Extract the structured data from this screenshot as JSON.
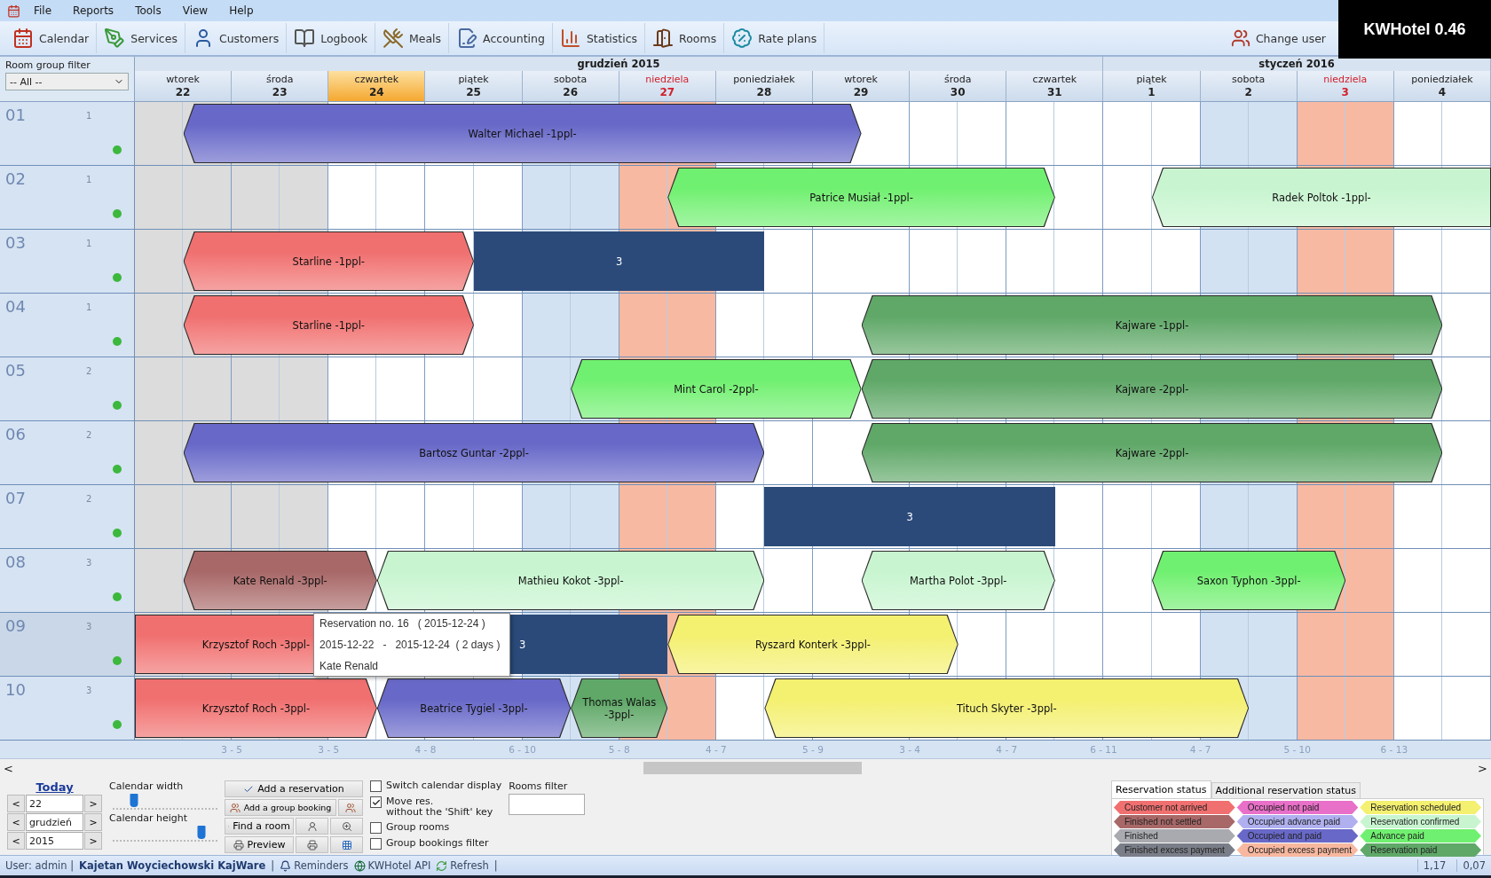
{
  "menu": [
    "File",
    "Reports",
    "Tools",
    "View",
    "Help"
  ],
  "toolbar": [
    {
      "label": "Calendar",
      "kind": "calendar"
    },
    {
      "label": "Services",
      "kind": "services"
    },
    {
      "label": "Customers",
      "kind": "customers"
    },
    {
      "label": "Logbook",
      "kind": "logbook"
    },
    {
      "label": "Meals",
      "kind": "meals"
    },
    {
      "label": "Accounting",
      "kind": "accounting"
    },
    {
      "label": "Statistics",
      "kind": "statistics"
    },
    {
      "label": "Rooms",
      "kind": "rooms"
    },
    {
      "label": "Rate plans",
      "kind": "rates"
    }
  ],
  "change_user": "Change user",
  "badge": "KWHotel 0.46",
  "room_filter": {
    "label": "Room group filter",
    "value": "-- All --"
  },
  "calendar": {
    "months": [
      {
        "label": "grudzień  2015",
        "days": [
          {
            "weekday": "wtorek",
            "day": "22",
            "kind": "weekday",
            "selected": false
          },
          {
            "weekday": "środa",
            "day": "23",
            "kind": "weekday",
            "selected": false
          },
          {
            "weekday": "czwartek",
            "day": "24",
            "kind": "weekday",
            "selected": true
          },
          {
            "weekday": "piątek",
            "day": "25",
            "kind": "weekday",
            "selected": false
          },
          {
            "weekday": "sobota",
            "day": "26",
            "kind": "saturday",
            "selected": false
          },
          {
            "weekday": "niedziela",
            "day": "27",
            "kind": "sunday",
            "selected": false
          },
          {
            "weekday": "poniedziałek",
            "day": "28",
            "kind": "weekday",
            "selected": false
          },
          {
            "weekday": "wtorek",
            "day": "29",
            "kind": "weekday",
            "selected": false
          },
          {
            "weekday": "środa",
            "day": "30",
            "kind": "weekday",
            "selected": false
          },
          {
            "weekday": "czwartek",
            "day": "31",
            "kind": "weekday",
            "selected": false
          }
        ]
      },
      {
        "label": "styczeń  2016",
        "days": [
          {
            "weekday": "piątek",
            "day": "1",
            "kind": "weekday",
            "selected": false
          },
          {
            "weekday": "sobota",
            "day": "2",
            "kind": "saturday",
            "selected": false
          },
          {
            "weekday": "niedziela",
            "day": "3",
            "kind": "sunday",
            "selected": false
          },
          {
            "weekday": "poniedziałek",
            "day": "4",
            "kind": "weekday",
            "selected": false
          }
        ]
      }
    ]
  },
  "rooms": [
    {
      "number": "01",
      "capacity": "1",
      "color": "#3cb83c",
      "selected": false,
      "reservations": [
        {
          "label": "Walter Michael -1ppl-",
          "kind": "reservation",
          "color": "#6868c8"
        }
      ]
    },
    {
      "number": "02",
      "capacity": "1",
      "color": "#3cb83c",
      "selected": false,
      "reservations": [
        {
          "label": "Patrice Musiał -1ppl-",
          "kind": "reservation",
          "color": "#70f070"
        },
        {
          "label": "Radek Poltok -1ppl-",
          "kind": "reservation",
          "color": "#c8f5d0"
        }
      ]
    },
    {
      "number": "03",
      "capacity": "1",
      "color": "#3cb83c",
      "selected": false,
      "reservations": [
        {
          "label": "Starline -1ppl-",
          "kind": "reservation",
          "color": "#f07070"
        },
        {
          "label": "3",
          "kind": "block",
          "color": "#2b4a7a"
        }
      ]
    },
    {
      "number": "04",
      "capacity": "1",
      "color": "#3cb83c",
      "selected": false,
      "reservations": [
        {
          "label": "Starline -1ppl-",
          "kind": "reservation",
          "color": "#f07070"
        },
        {
          "label": "Kajware -1ppl-",
          "kind": "reservation",
          "color": "#5fa868"
        }
      ]
    },
    {
      "number": "05",
      "capacity": "2",
      "color": "#3cb83c",
      "selected": false,
      "reservations": [
        {
          "label": "Mint Carol -2ppl-",
          "kind": "reservation",
          "color": "#70f070"
        },
        {
          "label": "Kajware -2ppl-",
          "kind": "reservation",
          "color": "#5fa868"
        }
      ]
    },
    {
      "number": "06",
      "capacity": "2",
      "color": "#3cb83c",
      "selected": false,
      "reservations": [
        {
          "label": "Bartosz Guntar -2ppl-",
          "kind": "reservation",
          "color": "#6868c8"
        },
        {
          "label": "Kajware -2ppl-",
          "kind": "reservation",
          "color": "#5fa868"
        }
      ]
    },
    {
      "number": "07",
      "capacity": "2",
      "color": "#3cb83c",
      "selected": false,
      "reservations": [
        {
          "label": "3",
          "kind": "block",
          "color": "#2b4a7a"
        }
      ]
    },
    {
      "number": "08",
      "capacity": "3",
      "color": "#3cb83c",
      "selected": false,
      "reservations": [
        {
          "label": "Kate Renald -3ppl-",
          "kind": "reservation",
          "color": "#a86868"
        },
        {
          "label": "Mathieu Kokot -3ppl-",
          "kind": "reservation",
          "color": "#c8f5d0"
        },
        {
          "label": "Martha Polot -3ppl-",
          "kind": "reservation",
          "color": "#c8f5d0"
        },
        {
          "label": "Saxon Typhon -3ppl-",
          "kind": "reservation",
          "color": "#70f070"
        }
      ]
    },
    {
      "number": "09",
      "capacity": "3",
      "color": "#3cb83c",
      "selected": true,
      "reservations": [
        {
          "label": "Krzysztof Roch -3ppl-",
          "kind": "reservation",
          "color": "#f07070"
        },
        {
          "label": "3",
          "kind": "block",
          "color": "#2b4a7a"
        },
        {
          "label": "Ryszard Konterk -3ppl-",
          "kind": "reservation",
          "color": "#f4f070"
        }
      ]
    },
    {
      "number": "10",
      "capacity": "3",
      "color": "#3cb83c",
      "selected": false,
      "reservations": [
        {
          "label": "Krzysztof Roch -3ppl-",
          "kind": "reservation",
          "color": "#f07070"
        },
        {
          "label": "Beatrice Tygiel -3ppl-",
          "kind": "reservation",
          "color": "#6868c8"
        },
        {
          "label": "Thomas Walas -3ppl-",
          "kind": "reservation",
          "color": "#5fa868"
        },
        {
          "label": "Tituch Skyter -3ppl-",
          "kind": "reservation",
          "color": "#f4f070"
        }
      ]
    }
  ],
  "occupancy": [
    "3 - 5",
    "3 - 5",
    "4 - 8",
    "6 - 10",
    "5 - 8",
    "4 - 7",
    "5 - 9",
    "3 - 4",
    "4 - 7",
    "6 - 11",
    "4 - 7",
    "5 - 10",
    "6 - 13"
  ],
  "tooltip": {
    "lines": [
      "Reservation no. 16   ( 2015-12-24 )",
      "2015-12-22   -   2015-12-24  ( 2 days )",
      "Kate Renald"
    ]
  },
  "scrollbar": {
    "prev": "<",
    "next": ">"
  },
  "controls": {
    "today": "Today",
    "spinners": [
      {
        "prev": "<",
        "value": "22",
        "next": ">"
      },
      {
        "prev": "<",
        "value": "grudzień",
        "next": ">"
      },
      {
        "prev": "<",
        "value": "2015",
        "next": ">"
      }
    ],
    "sliders": [
      {
        "label": "Calendar width",
        "level": 0.2
      },
      {
        "label": "Calendar height",
        "level": 0.85
      }
    ],
    "button_rows": [
      [
        {
          "label": "Add a reservation",
          "kind": "check"
        }
      ],
      [
        {
          "label": "Add a group booking",
          "kind": "group"
        },
        {
          "kind": "group"
        }
      ],
      [
        {
          "label": "Find a room",
          "kind": "search"
        },
        {
          "kind": "person"
        },
        {
          "kind": "zoom"
        }
      ],
      [
        {
          "label": "Preview",
          "kind": "print"
        },
        {
          "kind": "print"
        },
        {
          "kind": "grid"
        }
      ]
    ],
    "checkboxes": [
      {
        "label": "Switch calendar display",
        "checked": false
      },
      {
        "label": "Move res.\nwithout the 'Shift' key",
        "checked": true
      },
      {
        "label": "Group rooms",
        "checked": false
      },
      {
        "label": "Group bookings filter",
        "checked": false
      }
    ],
    "rooms_filter": {
      "label": "Rooms filter"
    }
  },
  "legend": {
    "tabs": [
      {
        "label": "Reservation status",
        "selected": true
      },
      {
        "label": "Additional reservation status",
        "selected": false
      }
    ],
    "items": [
      {
        "label": "Customer not arrived",
        "color": "#f07070"
      },
      {
        "label": "Occupied not paid",
        "color": "#e870c8"
      },
      {
        "label": "Reservation scheduled",
        "color": "#f4f070"
      },
      {
        "label": "Finished not settled",
        "color": "#a86868"
      },
      {
        "label": "Occupied advance paid",
        "color": "#b0b0f0"
      },
      {
        "label": "Reservation confirmed",
        "color": "#c8f5d0"
      },
      {
        "label": "Finished",
        "color": "#a8aab0"
      },
      {
        "label": "Occupied and paid",
        "color": "#6868c8"
      },
      {
        "label": "Advance paid",
        "color": "#70f070"
      },
      {
        "label": "Finished excess payment",
        "color": "#7a7e88"
      },
      {
        "label": "Occupied excess payment",
        "color": "#f8b8a0"
      },
      {
        "label": "Reservation paid",
        "color": "#5fa868"
      }
    ]
  },
  "status_bar": {
    "items": [
      {
        "kind": "text",
        "label": "User: admin |"
      },
      {
        "kind": "bold",
        "label": "Kajetan Woyciechowski KajWare"
      },
      {
        "kind": "text",
        "label": "|"
      },
      {
        "kind": "reminders",
        "label": "Reminders"
      },
      {
        "kind": "api",
        "label": "KWHotel API"
      },
      {
        "kind": "refresh",
        "label": "Refresh"
      },
      {
        "kind": "text",
        "label": "|"
      }
    ],
    "readings": [
      "1,17",
      "0,07"
    ]
  }
}
